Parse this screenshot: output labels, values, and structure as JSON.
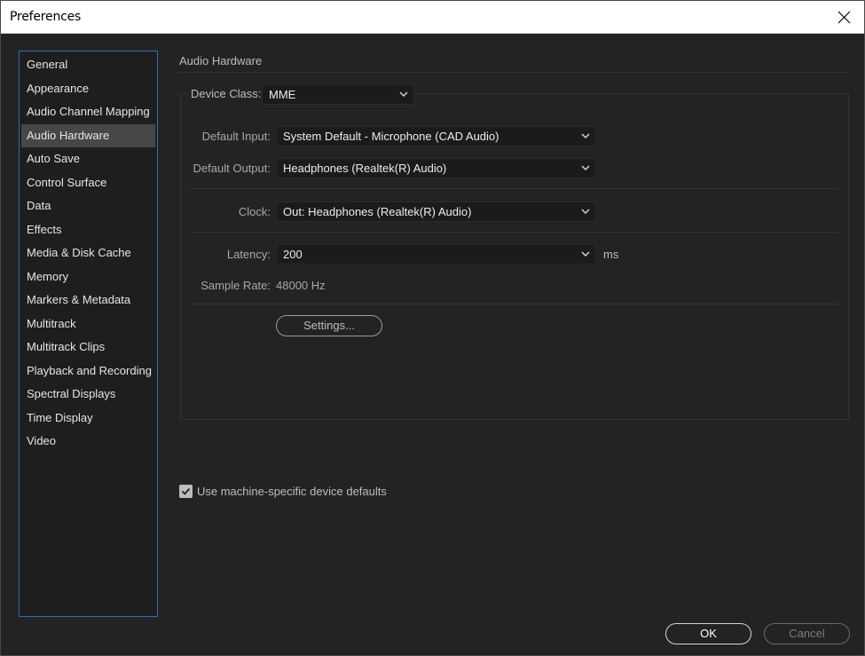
{
  "window": {
    "title": "Preferences",
    "close_icon": "close-icon"
  },
  "sidebar": {
    "items": [
      {
        "label": "General"
      },
      {
        "label": "Appearance"
      },
      {
        "label": "Audio Channel Mapping"
      },
      {
        "label": "Audio Hardware",
        "selected": true
      },
      {
        "label": "Auto Save"
      },
      {
        "label": "Control Surface"
      },
      {
        "label": "Data"
      },
      {
        "label": "Effects"
      },
      {
        "label": "Media & Disk Cache"
      },
      {
        "label": "Memory"
      },
      {
        "label": "Markers & Metadata"
      },
      {
        "label": "Multitrack"
      },
      {
        "label": "Multitrack Clips"
      },
      {
        "label": "Playback and Recording"
      },
      {
        "label": "Spectral Displays"
      },
      {
        "label": "Time Display"
      },
      {
        "label": "Video"
      }
    ]
  },
  "panel": {
    "title": "Audio Hardware",
    "device_class": {
      "label": "Device Class:",
      "value": "MME"
    },
    "default_input": {
      "label": "Default Input:",
      "value": "System Default - Microphone (CAD Audio)"
    },
    "default_output": {
      "label": "Default Output:",
      "value": "Headphones (Realtek(R) Audio)"
    },
    "clock": {
      "label": "Clock:",
      "value": "Out: Headphones (Realtek(R) Audio)"
    },
    "latency": {
      "label": "Latency:",
      "value": "200",
      "unit": "ms"
    },
    "sample_rate": {
      "label": "Sample Rate:",
      "value": "48000 Hz"
    },
    "settings_button": "Settings...",
    "machine_defaults": {
      "label": "Use machine-specific device defaults",
      "checked": true
    }
  },
  "footer": {
    "ok_label": "OK",
    "cancel_label": "Cancel"
  },
  "colors": {
    "background": "#232323",
    "sidebar_border": "#2d6fb5",
    "selected_item": "#474747"
  }
}
